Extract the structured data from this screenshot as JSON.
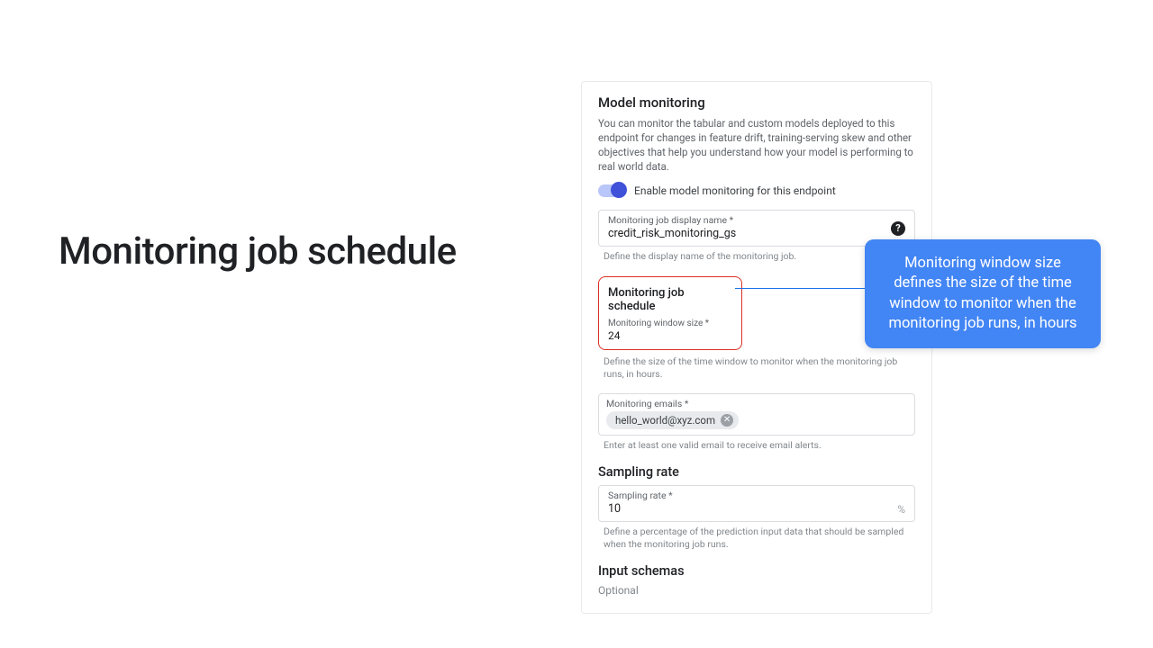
{
  "slide": {
    "title": "Monitoring job schedule"
  },
  "panel": {
    "heading": "Model monitoring",
    "description": "You can monitor the tabular and custom models deployed to this endpoint for changes in feature drift, training-serving skew and other objectives that help you understand how your model is performing to real world data.",
    "toggle_label": "Enable model monitoring for this endpoint",
    "job_name": {
      "label": "Monitoring job display name *",
      "value": "credit_risk_monitoring_gs",
      "helper": "Define the display name of the monitoring job."
    },
    "schedule": {
      "title": "Monitoring job schedule",
      "window_label": "Monitoring window size *",
      "window_value": "24",
      "helper": "Define the size of the time window to monitor when the monitoring job runs, in hours."
    },
    "emails": {
      "label": "Monitoring emails *",
      "chip": "hello_world@xyz.com",
      "helper": "Enter at least one valid email to receive email alerts."
    },
    "sampling": {
      "title": "Sampling rate",
      "label": "Sampling rate *",
      "value": "10",
      "suffix": "%",
      "helper": "Define a percentage of the prediction input data that should be sampled when the monitoring job runs."
    },
    "input_schemas": {
      "title": "Input schemas",
      "subtext": "Optional"
    }
  },
  "callout": {
    "text": "Monitoring window size defines the size of the time window to monitor when the monitoring job runs, in hours"
  },
  "icons": {
    "help": "?",
    "close": "✕"
  }
}
